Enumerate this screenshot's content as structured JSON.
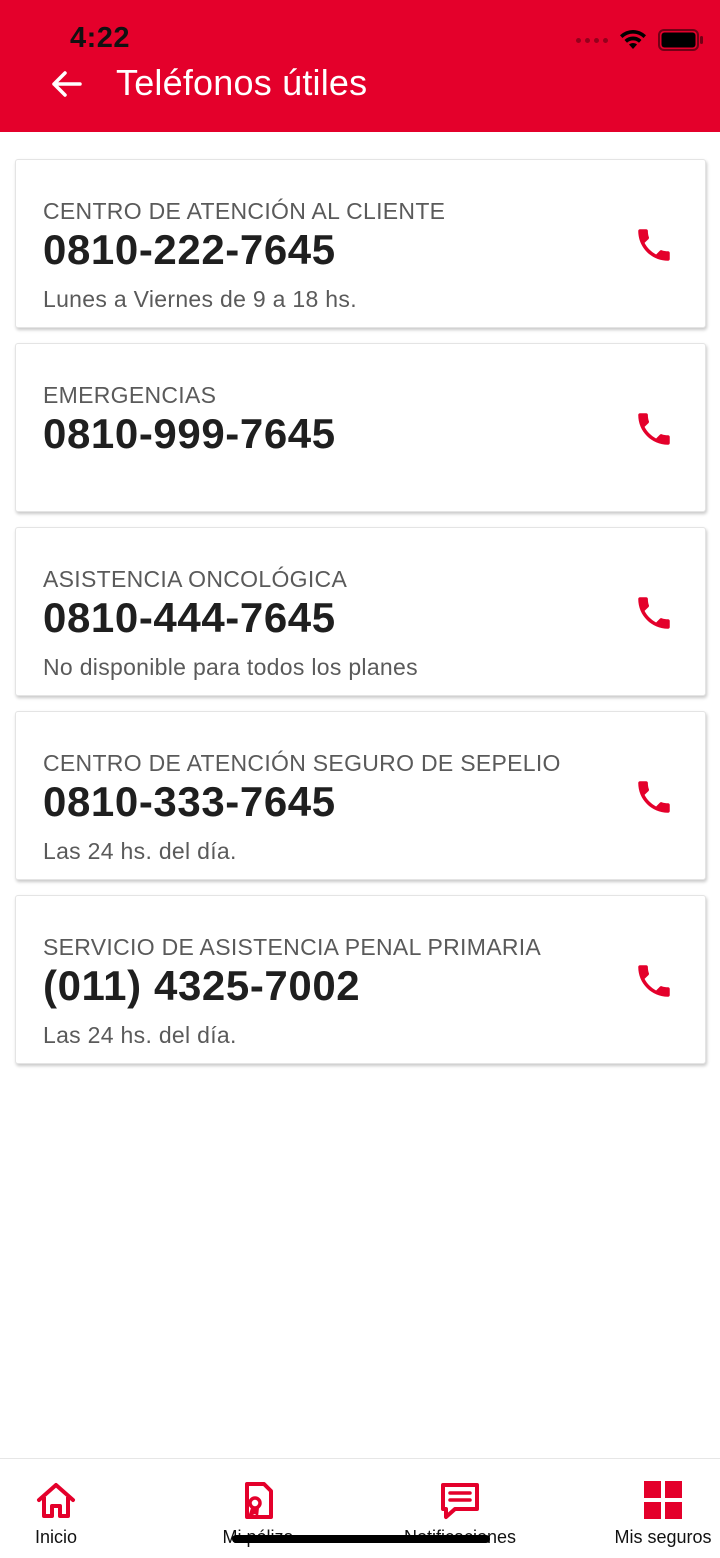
{
  "status_bar": {
    "time": "4:22"
  },
  "header": {
    "title": "Teléfonos útiles"
  },
  "contacts": [
    {
      "title": "CENTRO DE ATENCIÓN AL CLIENTE",
      "number": "0810-222-7645",
      "hours": "Lunes a Viernes de 9 a 18 hs."
    },
    {
      "title": "EMERGENCIAS",
      "number": "0810-999-7645",
      "hours": ""
    },
    {
      "title": "ASISTENCIA ONCOLÓGICA",
      "number": "0810-444-7645",
      "hours": "No disponible para todos los planes"
    },
    {
      "title": "CENTRO DE ATENCIÓN SEGURO DE SEPELIO",
      "number": "0810-333-7645",
      "hours": "Las 24 hs. del día."
    },
    {
      "title": "SERVICIO DE ASISTENCIA PENAL PRIMARIA",
      "number": "(011) 4325-7002",
      "hours": "Las 24 hs. del día."
    }
  ],
  "bottom_nav": [
    {
      "label": "Inicio",
      "icon": "home-icon"
    },
    {
      "label": "Mi póliza",
      "icon": "policy-icon"
    },
    {
      "label": "Notificaciones",
      "icon": "notifications-icon"
    },
    {
      "label": "Mis seguros",
      "icon": "grid-icon"
    }
  ],
  "colors": {
    "brand": "#e4002b",
    "text_primary": "#1f1f1f",
    "text_secondary": "#5a5a5a"
  }
}
